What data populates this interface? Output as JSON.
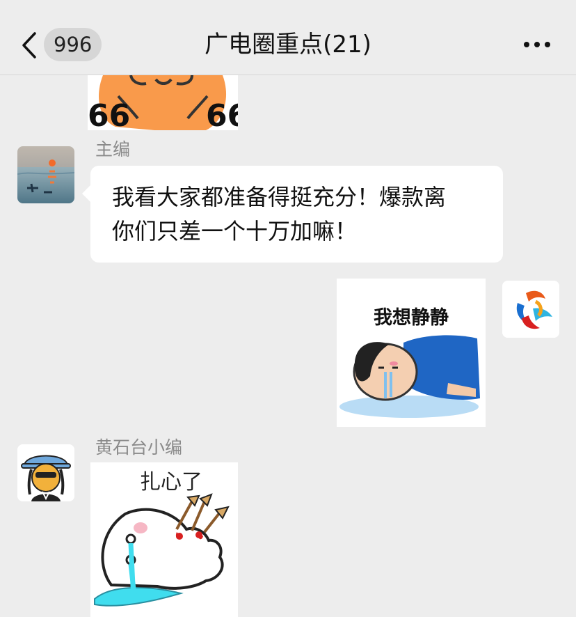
{
  "header": {
    "unread_count": "996",
    "title": "广电圈重点(21)"
  },
  "messages": [
    {
      "type": "sticker",
      "side": "left",
      "sticker": "orange-cat-sticker"
    },
    {
      "type": "text",
      "side": "left",
      "sender": "主编",
      "avatar": "sunrise-painting-avatar",
      "lines": [
        "我看大家都准备得挺充分！爆款离",
        "你们只差一个十万加嘛！"
      ]
    },
    {
      "type": "sticker",
      "side": "right",
      "avatar": "colorful-logo-avatar",
      "sticker_text": "我想静静"
    },
    {
      "type": "sticker",
      "side": "left",
      "sender": "黄石台小编",
      "avatar": "cartoon-hat-avatar",
      "sticker_text": "扎心了"
    }
  ],
  "colors": {
    "background": "#ededed",
    "bubble": "#ffffff",
    "badge": "#d6d6d6",
    "name_gray": "#8a8a8a"
  }
}
